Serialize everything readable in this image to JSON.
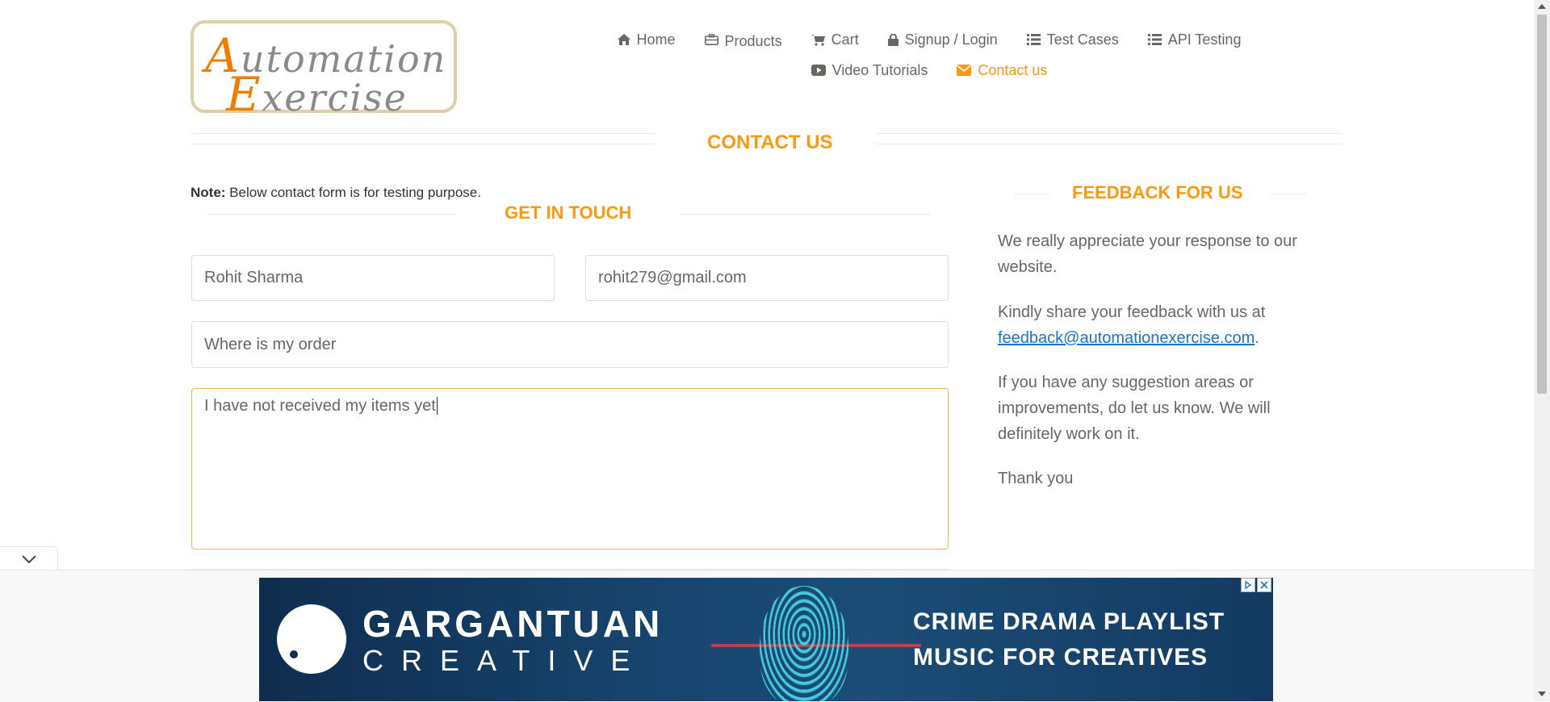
{
  "logo": {
    "line1_cap": "A",
    "line1_rest": "utomation",
    "line2_cap": "E",
    "line2_rest": "xercise"
  },
  "nav": {
    "row1": [
      {
        "label": "Home",
        "icon": "home-icon"
      },
      {
        "label": "Products",
        "icon": "briefcase-icon"
      },
      {
        "label": "Cart",
        "icon": "cart-icon"
      },
      {
        "label": "Signup / Login",
        "icon": "lock-icon"
      },
      {
        "label": "Test Cases",
        "icon": "list-icon"
      },
      {
        "label": "API Testing",
        "icon": "list-icon"
      }
    ],
    "row2": [
      {
        "label": "Video Tutorials",
        "icon": "youtube-icon"
      },
      {
        "label": "Contact us",
        "icon": "envelope-icon",
        "active": true
      }
    ]
  },
  "page": {
    "title": "CONTACT US",
    "note_bold": "Note:",
    "note_text": " Below contact form is for testing purpose.",
    "form_title": "GET IN TOUCH"
  },
  "form": {
    "name_value": "Rohit Sharma",
    "email_value": "rohit279@gmail.com",
    "subject_value": "Where is my order",
    "message_value": "I have not received my items yet"
  },
  "feedback": {
    "title": "FEEDBACK FOR US",
    "p1": "We really appreciate your response to our website.",
    "p2_text": "Kindly share your feedback with us at",
    "p2_link": "feedback@automationexercise.com",
    "p2_end": ".",
    "p3": "If you have any suggestion areas or improvements, do let us know. We will definitely work on it.",
    "p4": "Thank you"
  },
  "ad": {
    "brand_line1": "GARGANTUAN",
    "brand_line2": "CREATIVE",
    "headline1": "CRIME DRAMA PLAYLIST",
    "headline2": "MUSIC FOR CREATIVES"
  },
  "colors": {
    "accent": "#fe980f",
    "text": "#696763",
    "link": "#1a73c8"
  }
}
